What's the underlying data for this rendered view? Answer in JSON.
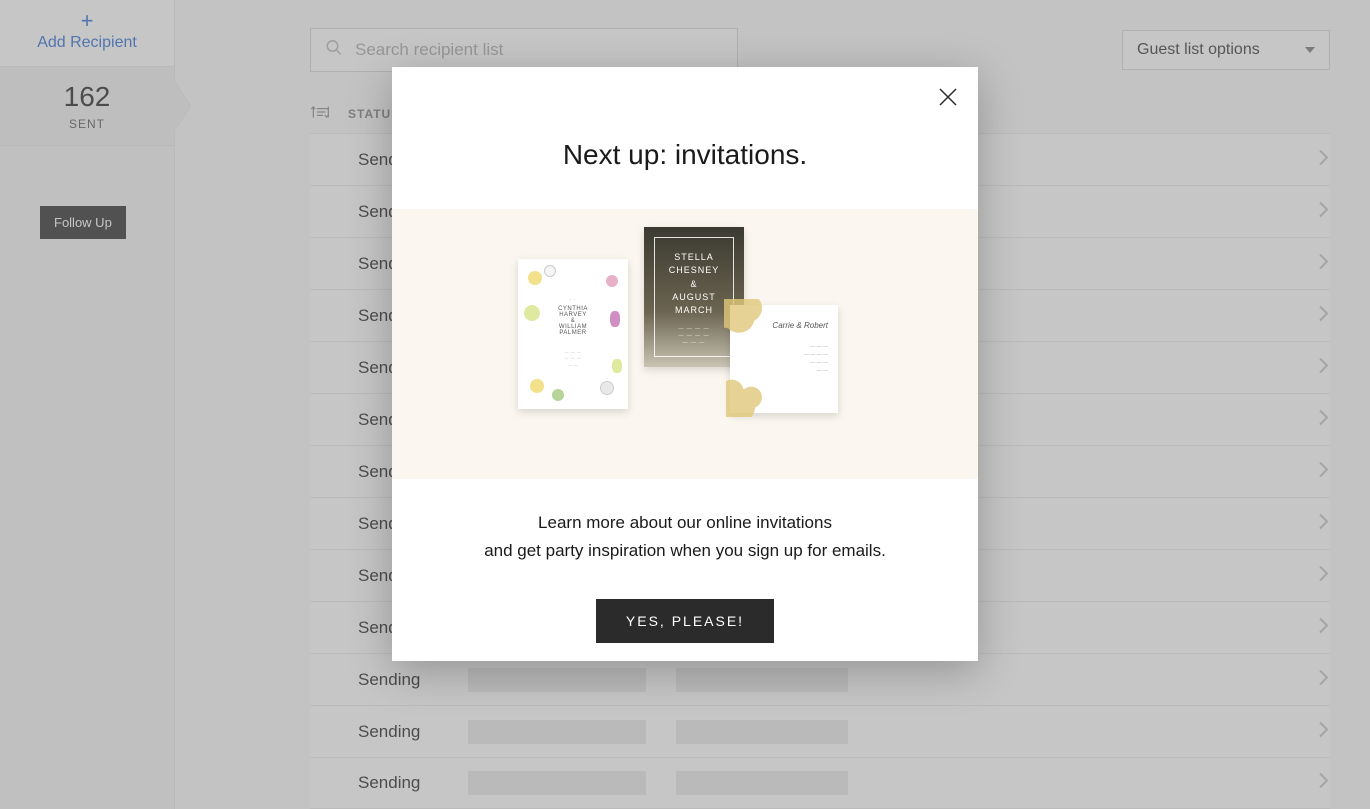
{
  "sidebar": {
    "add_label": "Add Recipient",
    "count": "162",
    "count_label": "SENT",
    "followup_label": "Follow Up"
  },
  "topbar": {
    "search_placeholder": "Search recipient list",
    "guest_options_label": "Guest list options"
  },
  "table": {
    "status_header": "STATUS",
    "rows": [
      {
        "status": "Sending"
      },
      {
        "status": "Sending"
      },
      {
        "status": "Sending"
      },
      {
        "status": "Sending"
      },
      {
        "status": "Sending"
      },
      {
        "status": "Sending"
      },
      {
        "status": "Sending"
      },
      {
        "status": "Sending"
      },
      {
        "status": "Sending"
      },
      {
        "status": "Sending"
      },
      {
        "status": "Sending"
      },
      {
        "status": "Sending"
      },
      {
        "status": "Sending"
      }
    ]
  },
  "modal": {
    "title": "Next up: invitations.",
    "body_line1": "Learn more about our online invitations",
    "body_line2": "and get party inspiration when you sign up for emails.",
    "cta_label": "YES, PLEASE!",
    "card_mid": {
      "name1": "STELLA",
      "name2": "CHESNEY",
      "amp": "&",
      "name3": "AUGUST",
      "name4": "MARCH"
    },
    "card_left": {
      "name1": "CYNTHIA",
      "name2": "HARVEY",
      "amp": "&",
      "name3": "WILLIAM",
      "name4": "PALMER"
    },
    "card_right": {
      "names": "Carrie & Robert"
    }
  }
}
